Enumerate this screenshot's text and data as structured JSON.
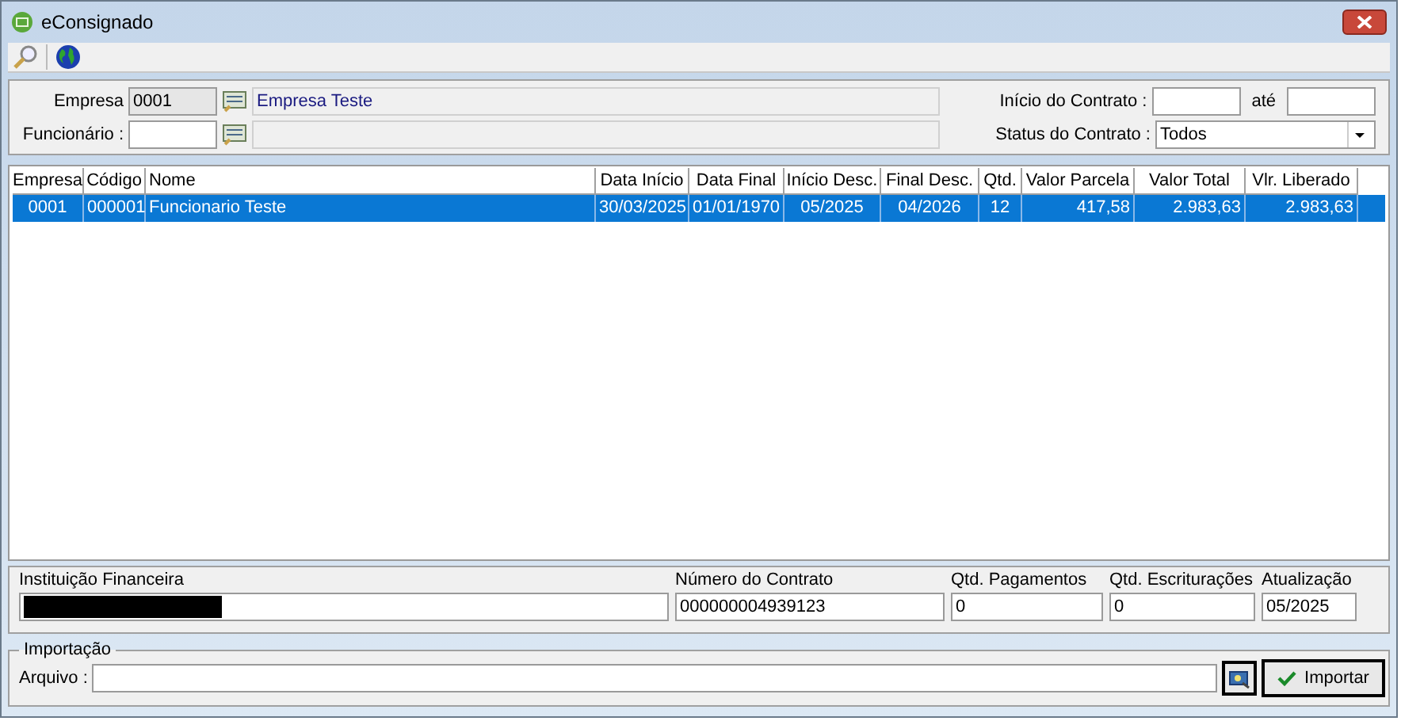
{
  "window": {
    "title": "eConsignado"
  },
  "filters": {
    "empresa_label": "Empresa",
    "empresa_code": "0001",
    "empresa_name": "Empresa Teste",
    "funcionario_label": "Funcionário :",
    "inicio_label": "Início do Contrato :",
    "ate_label": "até",
    "status_label": "Status do Contrato :",
    "status_value": "Todos"
  },
  "table": {
    "columns": [
      "Empresa",
      "Código",
      "Nome",
      "Data Início",
      "Data Final",
      "Início Desc.",
      "Final Desc.",
      "Qtd.",
      "Valor Parcela",
      "Valor Total",
      "Vlr. Liberado"
    ],
    "rows": [
      {
        "selected": true,
        "cells": [
          "0001",
          "000001",
          "Funcionario Teste",
          "30/03/2025",
          "01/01/1970",
          "05/2025",
          "04/2026",
          "12",
          "417,58",
          "2.983,63",
          "2.983,63"
        ]
      }
    ]
  },
  "details": [
    {
      "label": "Instituição Financeira",
      "redacted": true
    },
    {
      "label": "Número do Contrato",
      "value": "000000004939123",
      "redacted": false
    },
    {
      "label": "Qtd. Pagamentos",
      "value": "0",
      "redacted": false
    },
    {
      "label": "Qtd. Escriturações",
      "value": "0",
      "redacted": false
    },
    {
      "label": "Atualização",
      "value": "05/2025",
      "redacted": false
    }
  ],
  "import": {
    "legend": "Importação",
    "file_label": "Arquivo :",
    "button": "Importar"
  }
}
